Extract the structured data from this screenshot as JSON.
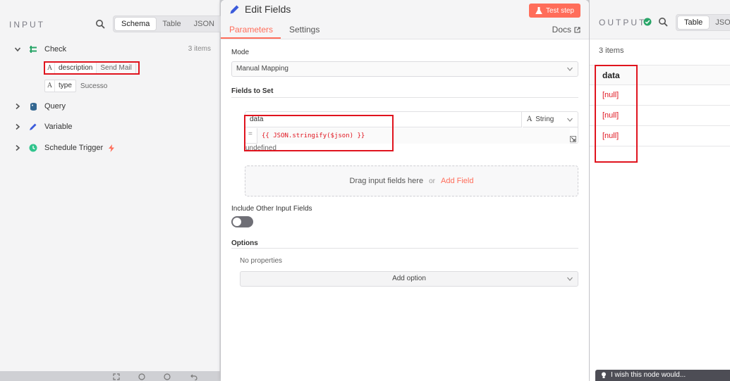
{
  "input": {
    "title": "INPUT",
    "view_tabs": [
      "Schema",
      "Table",
      "JSON"
    ],
    "active_tab": "Schema",
    "nodes": [
      {
        "label": "Check",
        "count": "3 items",
        "icon": "check-node-icon",
        "expanded": true,
        "fields": [
          {
            "type": "A",
            "name": "description",
            "value": "Send Mail"
          },
          {
            "type": "A",
            "name": "type",
            "value": "Sucesso"
          }
        ]
      },
      {
        "label": "Query",
        "icon": "database-icon"
      },
      {
        "label": "Variable",
        "icon": "pencil-icon"
      },
      {
        "label": "Schedule Trigger",
        "icon": "clock-icon",
        "trigger": true
      }
    ]
  },
  "editor": {
    "title": "Edit Fields",
    "test_label": "Test step",
    "tabs": {
      "parameters": "Parameters",
      "settings": "Settings"
    },
    "docs_label": "Docs",
    "mode_label": "Mode",
    "mode_value": "Manual Mapping",
    "fields_label": "Fields to Set",
    "assignment": {
      "name": "data",
      "type": "String",
      "eq": "=",
      "expression": "{{ JSON.stringify($json) }}",
      "preview": "undefined"
    },
    "dropzone": {
      "text": "Drag input fields here",
      "or": "or",
      "add": "Add Field"
    },
    "include_label": "Include Other Input Fields",
    "include_on": false,
    "options_label": "Options",
    "no_props": "No properties",
    "add_option": "Add option"
  },
  "output": {
    "title": "OUTPUT",
    "view_tabs": [
      "Table",
      "JSON"
    ],
    "active_tab": "Table",
    "items": "3 items",
    "column": "data",
    "rows": [
      "[null]",
      "[null]",
      "[null]"
    ],
    "hint": "I wish this node would..."
  },
  "colors": {
    "accent": "#ff6d5a",
    "highlight": "#e0141e",
    "success": "#29a568"
  }
}
